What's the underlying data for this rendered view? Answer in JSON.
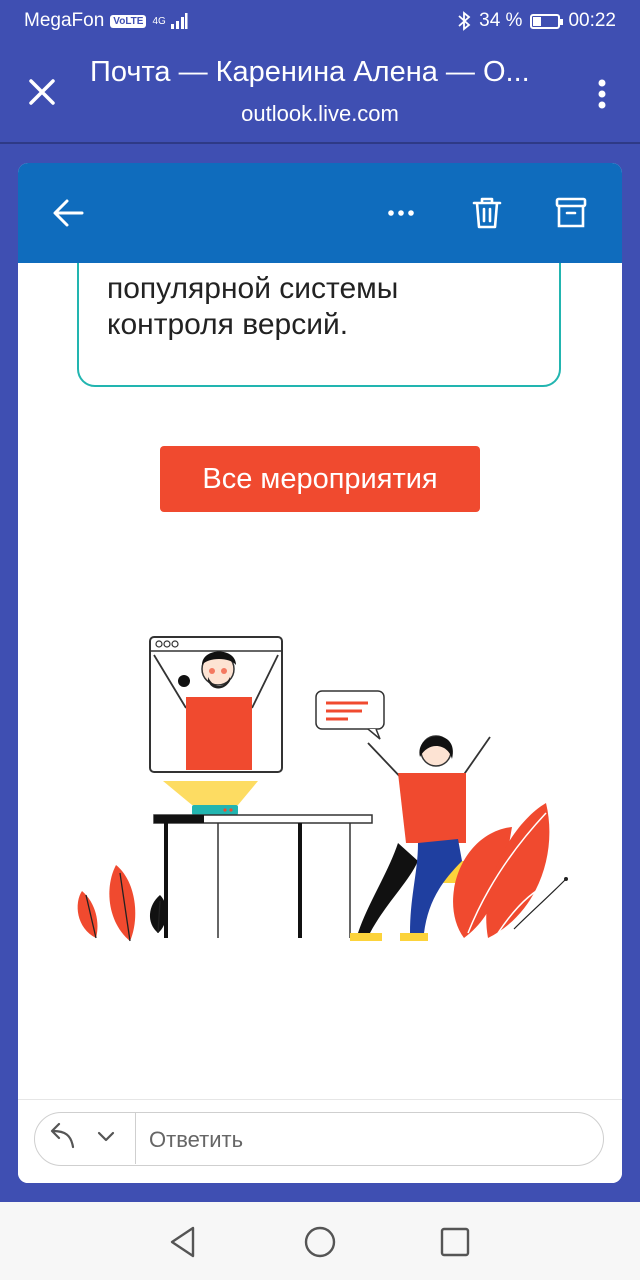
{
  "status": {
    "carrier": "MegaFon",
    "volte": "VoLTE",
    "network": "4G",
    "battery_text": "34 %",
    "battery_level": 0.34,
    "time": "00:22"
  },
  "browser": {
    "title": "Почта — Каренина Алена — О...",
    "url": "outlook.live.com"
  },
  "email": {
    "body_text": "популярной системы\nконтроля версий.",
    "cta_label": "Все мероприятия"
  },
  "reply": {
    "placeholder": "Ответить"
  },
  "colors": {
    "app_bar": "#3f4fb2",
    "toolbar": "#0f6cbd",
    "accent_button": "#f04a2f",
    "teal_border": "#22b5b0"
  }
}
